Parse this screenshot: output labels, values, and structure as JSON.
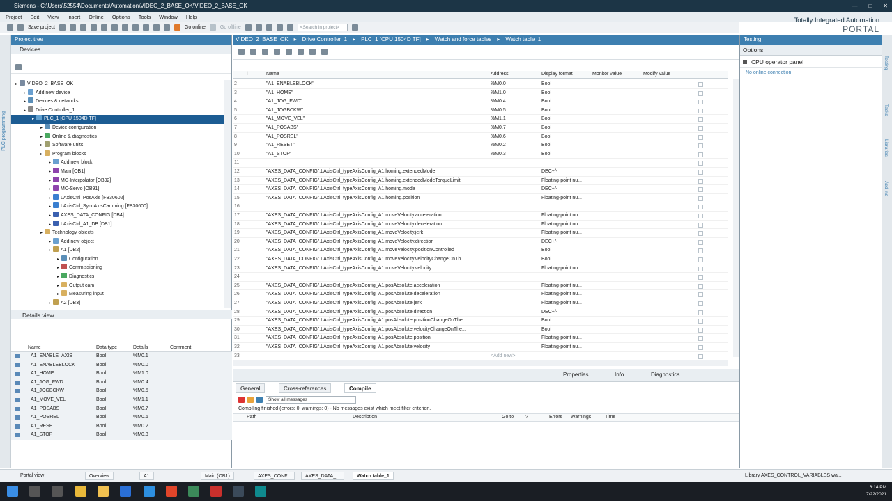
{
  "window": {
    "title": "Siemens - C:\\Users\\52554\\Documents\\Automation\\VIDEO_2_BASE_OK\\VIDEO_2_BASE_OK"
  },
  "menu": [
    "Project",
    "Edit",
    "View",
    "Insert",
    "Online",
    "Options",
    "Tools",
    "Window",
    "Help"
  ],
  "toolbar": {
    "save_label": "Save project",
    "go_online": "Go online",
    "go_offline": "Go offline",
    "search_placeholder": "<Search in project>"
  },
  "brand": {
    "line1": "Totally Integrated Automation",
    "line2": "PORTAL"
  },
  "project_tree": {
    "title": "Project tree",
    "tab": "Devices",
    "side_label": "PLC programming",
    "items": [
      {
        "label": "VIDEO_2_BASE_OK",
        "indent": 0,
        "icon": "#7a8ba0"
      },
      {
        "label": "Add new device",
        "indent": 1,
        "icon": "#6aa0d0"
      },
      {
        "label": "Devices & networks",
        "indent": 1,
        "icon": "#5b8fb8"
      },
      {
        "label": "Drive Controller_1",
        "indent": 1,
        "icon": "#888"
      },
      {
        "label": "PLC_1 [CPU 1504D TF]",
        "indent": 2,
        "icon": "#5fa0d0",
        "selected": true
      },
      {
        "label": "Device configuration",
        "indent": 3,
        "icon": "#5b8fb8"
      },
      {
        "label": "Online & diagnostics",
        "indent": 3,
        "icon": "#4aa860"
      },
      {
        "label": "Software units",
        "indent": 3,
        "icon": "#a0a070"
      },
      {
        "label": "Program blocks",
        "indent": 3,
        "icon": "#d8b060"
      },
      {
        "label": "Add new block",
        "indent": 4,
        "icon": "#6aa0d0"
      },
      {
        "label": "Main [OB1]",
        "indent": 4,
        "icon": "#8e44ad"
      },
      {
        "label": "MC-Interpolator [OB92]",
        "indent": 4,
        "icon": "#8e44ad"
      },
      {
        "label": "MC-Servo [OB91]",
        "indent": 4,
        "icon": "#8e44ad"
      },
      {
        "label": "LAxisCtrl_PosAxis [FB30602]",
        "indent": 4,
        "icon": "#3a7fd0"
      },
      {
        "label": "LAxisCtrl_SyncAxisCamming [FB30600]",
        "indent": 4,
        "icon": "#3a7fd0"
      },
      {
        "label": "AXES_DATA_CONFIG [DB4]",
        "indent": 4,
        "icon": "#3a60b0"
      },
      {
        "label": "LAxisCtrl_A1_DB [DB1]",
        "indent": 4,
        "icon": "#3a60b0"
      },
      {
        "label": "Technology objects",
        "indent": 3,
        "icon": "#d8b060"
      },
      {
        "label": "Add new object",
        "indent": 4,
        "icon": "#6aa0d0"
      },
      {
        "label": "A1 [DB2]",
        "indent": 4,
        "icon": "#c0a050"
      },
      {
        "label": "Configuration",
        "indent": 5,
        "icon": "#5b8fb8"
      },
      {
        "label": "Commissioning",
        "indent": 5,
        "icon": "#c05050"
      },
      {
        "label": "Diagnostics",
        "indent": 5,
        "icon": "#4aa860"
      },
      {
        "label": "Output cam",
        "indent": 5,
        "icon": "#d8b060"
      },
      {
        "label": "Measuring input",
        "indent": 5,
        "icon": "#d8b060"
      },
      {
        "label": "A2 [DB3]",
        "indent": 4,
        "icon": "#c0a050"
      }
    ]
  },
  "details": {
    "title": "Details view",
    "columns": [
      "Name",
      "Data type",
      "Details",
      "Comment"
    ],
    "rows": [
      {
        "name": "A1_ENABLE_AXIS",
        "type": "Bool",
        "addr": "%M0.1"
      },
      {
        "name": "A1_ENABLEBLOCK",
        "type": "Bool",
        "addr": "%M0.0"
      },
      {
        "name": "A1_HOME",
        "type": "Bool",
        "addr": "%M1.0"
      },
      {
        "name": "A1_JOG_FWD",
        "type": "Bool",
        "addr": "%M0.4"
      },
      {
        "name": "A1_JOGBCKW",
        "type": "Bool",
        "addr": "%M0.5"
      },
      {
        "name": "A1_MOVE_VEL",
        "type": "Bool",
        "addr": "%M1.1"
      },
      {
        "name": "A1_POSABS",
        "type": "Bool",
        "addr": "%M0.7"
      },
      {
        "name": "A1_POSREL",
        "type": "Bool",
        "addr": "%M0.6"
      },
      {
        "name": "A1_RESET",
        "type": "Bool",
        "addr": "%M0.2"
      },
      {
        "name": "A1_STOP",
        "type": "Bool",
        "addr": "%M0.3"
      }
    ]
  },
  "editor": {
    "breadcrumb": [
      "VIDEO_2_BASE_OK",
      "Drive Controller_1",
      "PLC_1 [CPU 1504D TF]",
      "Watch and force tables",
      "Watch table_1"
    ],
    "columns": [
      "i",
      "Name",
      "Address",
      "Display format",
      "Monitor value",
      "Modify value"
    ],
    "rows": [
      {
        "n": "2",
        "name": "\"A1_ENABLEBLOCK\"",
        "addr": "%M0.0",
        "fmt": "Bool"
      },
      {
        "n": "3",
        "name": "\"A1_HOME\"",
        "addr": "%M1.0",
        "fmt": "Bool"
      },
      {
        "n": "4",
        "name": "\"A1_JOG_FWD\"",
        "addr": "%M0.4",
        "fmt": "Bool"
      },
      {
        "n": "5",
        "name": "\"A1_JOGBCKW\"",
        "addr": "%M0.5",
        "fmt": "Bool"
      },
      {
        "n": "6",
        "name": "\"A1_MOVE_VEL\"",
        "addr": "%M1.1",
        "fmt": "Bool"
      },
      {
        "n": "7",
        "name": "\"A1_POSABS\"",
        "addr": "%M0.7",
        "fmt": "Bool"
      },
      {
        "n": "8",
        "name": "\"A1_POSREL\"",
        "addr": "%M0.6",
        "fmt": "Bool"
      },
      {
        "n": "9",
        "name": "\"A1_RESET\"",
        "addr": "%M0.2",
        "fmt": "Bool"
      },
      {
        "n": "10",
        "name": "\"A1_STOP\"",
        "addr": "%M0.3",
        "fmt": "Bool"
      },
      {
        "n": "11",
        "name": "",
        "addr": "",
        "fmt": ""
      },
      {
        "n": "12",
        "name": "\"AXES_DATA_CONFIG\".LAxisCtrl_typeAxisConfig_A1.homing.extendedMode",
        "addr": "",
        "fmt": "DEC+/-"
      },
      {
        "n": "13",
        "name": "\"AXES_DATA_CONFIG\".LAxisCtrl_typeAxisConfig_A1.homing.extendedModeTorqueLimit",
        "addr": "",
        "fmt": "Floating-point nu..."
      },
      {
        "n": "14",
        "name": "\"AXES_DATA_CONFIG\".LAxisCtrl_typeAxisConfig_A1.homing.mode",
        "addr": "",
        "fmt": "DEC+/-"
      },
      {
        "n": "15",
        "name": "\"AXES_DATA_CONFIG\".LAxisCtrl_typeAxisConfig_A1.homing.position",
        "addr": "",
        "fmt": "Floating-point nu..."
      },
      {
        "n": "16",
        "name": "",
        "addr": "",
        "fmt": ""
      },
      {
        "n": "17",
        "name": "\"AXES_DATA_CONFIG\".LAxisCtrl_typeAxisConfig_A1.moveVelocity.acceleration",
        "addr": "",
        "fmt": "Floating-point nu..."
      },
      {
        "n": "18",
        "name": "\"AXES_DATA_CONFIG\".LAxisCtrl_typeAxisConfig_A1.moveVelocity.deceleration",
        "addr": "",
        "fmt": "Floating-point nu..."
      },
      {
        "n": "19",
        "name": "\"AXES_DATA_CONFIG\".LAxisCtrl_typeAxisConfig_A1.moveVelocity.jerk",
        "addr": "",
        "fmt": "Floating-point nu..."
      },
      {
        "n": "20",
        "name": "\"AXES_DATA_CONFIG\".LAxisCtrl_typeAxisConfig_A1.moveVelocity.direction",
        "addr": "",
        "fmt": "DEC+/-"
      },
      {
        "n": "21",
        "name": "\"AXES_DATA_CONFIG\".LAxisCtrl_typeAxisConfig_A1.moveVelocity.positionControlled",
        "addr": "",
        "fmt": "Bool"
      },
      {
        "n": "22",
        "name": "\"AXES_DATA_CONFIG\".LAxisCtrl_typeAxisConfig_A1.moveVelocity.velocityChangeOnTh...",
        "addr": "",
        "fmt": "Bool"
      },
      {
        "n": "23",
        "name": "\"AXES_DATA_CONFIG\".LAxisCtrl_typeAxisConfig_A1.moveVelocity.velocity",
        "addr": "",
        "fmt": "Floating-point nu..."
      },
      {
        "n": "24",
        "name": "",
        "addr": "",
        "fmt": ""
      },
      {
        "n": "25",
        "name": "\"AXES_DATA_CONFIG\".LAxisCtrl_typeAxisConfig_A1.posAbsolute.acceleration",
        "addr": "",
        "fmt": "Floating-point nu..."
      },
      {
        "n": "26",
        "name": "\"AXES_DATA_CONFIG\".LAxisCtrl_typeAxisConfig_A1.posAbsolute.deceleration",
        "addr": "",
        "fmt": "Floating-point nu..."
      },
      {
        "n": "27",
        "name": "\"AXES_DATA_CONFIG\".LAxisCtrl_typeAxisConfig_A1.posAbsolute.jerk",
        "addr": "",
        "fmt": "Floating-point nu..."
      },
      {
        "n": "28",
        "name": "\"AXES_DATA_CONFIG\".LAxisCtrl_typeAxisConfig_A1.posAbsolute.direction",
        "addr": "",
        "fmt": "DEC+/-"
      },
      {
        "n": "29",
        "name": "\"AXES_DATA_CONFIG\".LAxisCtrl_typeAxisConfig_A1.posAbsolute.positionChangeOnThe...",
        "addr": "",
        "fmt": "Bool"
      },
      {
        "n": "30",
        "name": "\"AXES_DATA_CONFIG\".LAxisCtrl_typeAxisConfig_A1.posAbsolute.velocityChangeOnThe...",
        "addr": "",
        "fmt": "Bool"
      },
      {
        "n": "31",
        "name": "\"AXES_DATA_CONFIG\".LAxisCtrl_typeAxisConfig_A1.posAbsolute.position",
        "addr": "",
        "fmt": "Floating-point nu..."
      },
      {
        "n": "32",
        "name": "\"AXES_DATA_CONFIG\".LAxisCtrl_typeAxisConfig_A1.posAbsolute.velocity",
        "addr": "",
        "fmt": "Floating-point nu..."
      },
      {
        "n": "33",
        "name": "",
        "addr": "<Add new>",
        "fmt": ""
      }
    ]
  },
  "bottom": {
    "tabs": [
      "General",
      "Cross-references",
      "Compile"
    ],
    "right_tabs": [
      "Properties",
      "Info",
      "Diagnostics"
    ],
    "filter": "Show all messages",
    "message": "Compiling finished (errors: 0; warnings: 0) - No messages exist which meet filter criterion.",
    "columns": [
      "Path",
      "Description",
      "Go to",
      "?",
      "Errors",
      "Warnings",
      "Time"
    ]
  },
  "right": {
    "title": "Testing",
    "options": "Options",
    "section": "CPU operator panel",
    "status": "No online connection",
    "side_tabs": [
      "Testing",
      "Tasks",
      "Libraries",
      "Add-ins"
    ]
  },
  "statusbar": {
    "portal": "Portal view",
    "items": [
      "Overview",
      "A1",
      "Main (OB1)",
      "AXES_CONF...",
      "AXES_DATA_...",
      "Watch table_1"
    ],
    "library_msg": "Library AXES_CONTROL_VARIABLES wa..."
  },
  "clock": {
    "time": "6:14 PM",
    "date": "7/22/2021"
  }
}
